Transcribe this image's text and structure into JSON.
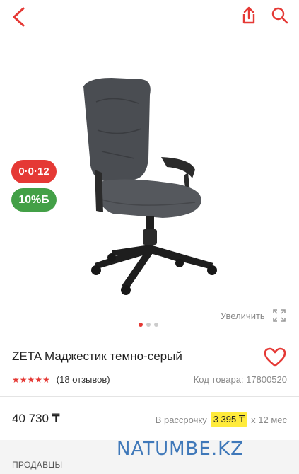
{
  "header": {
    "back_icon": "chevron-left-icon",
    "share_icon": "share-icon",
    "search_icon": "search-icon",
    "accent": "#e53935"
  },
  "gallery": {
    "badges": [
      {
        "text": "0·0·12",
        "color": "#e53935"
      },
      {
        "text": "10%Б",
        "color": "#43a047"
      }
    ],
    "zoom_label": "Увеличить",
    "dot_count": 3,
    "active_dot": 0
  },
  "product": {
    "title": "ZETA Маджестик темно-серый",
    "rating": 5,
    "stars": "★★★★★",
    "reviews": "(18 отзывов)",
    "code": "Код товара: 17800520"
  },
  "pricing": {
    "price": "40 730 ₸",
    "installment_prefix": "В рассрочку",
    "installment_amount": "3 395 ₸",
    "installment_suffix": "x 12 мес"
  },
  "sellers": {
    "label": "ПРОДАВЦЫ"
  },
  "watermark": "NATUMBE.KZ"
}
